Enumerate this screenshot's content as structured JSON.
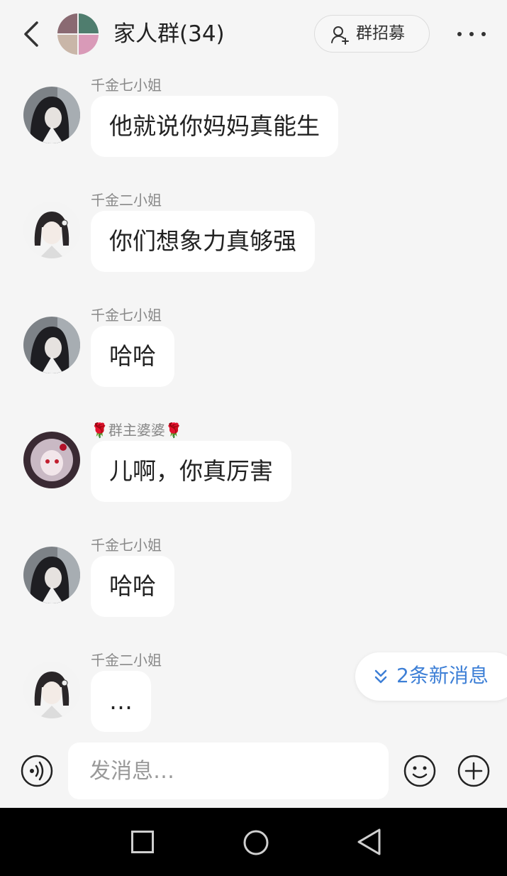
{
  "header": {
    "title": "家人群(34)",
    "recruit_label": "群招募",
    "back_icon": "chevron-left-icon",
    "more_icon": "more-horizontal-icon"
  },
  "messages": [
    {
      "sender": "千金七小姐",
      "text": "他就说你妈妈真能生"
    },
    {
      "sender": "千金二小姐",
      "text": "你们想象力真够强"
    },
    {
      "sender": "千金七小姐",
      "text": "哈哈"
    },
    {
      "sender": "🌹群主婆婆🌹",
      "text": "儿啊，你真厉害"
    },
    {
      "sender": "千金七小姐",
      "text": "哈哈"
    },
    {
      "sender": "千金二小姐",
      "text": "…"
    }
  ],
  "new_messages": {
    "label": "2条新消息"
  },
  "input": {
    "placeholder": "发消息…"
  },
  "colors": {
    "accent": "#3d7fd6",
    "background": "#f5f5f5",
    "bubble": "#ffffff",
    "navbar": "#000000"
  }
}
